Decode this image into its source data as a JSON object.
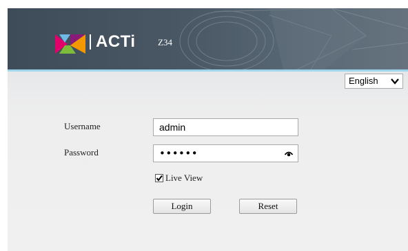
{
  "header": {
    "brand": "ACTi",
    "model": "Z34"
  },
  "language": {
    "selected": "English"
  },
  "form": {
    "username_label": "Username",
    "username_value": "admin",
    "password_label": "Password",
    "password_masked": "••••••",
    "liveview_label": "Live View",
    "liveview_checked": true,
    "login_label": "Login",
    "reset_label": "Reset"
  },
  "icons": {
    "logo": "acti-logo-icon",
    "lang_arrow": "chevron-down-icon",
    "reveal": "eye-icon",
    "check": "checkmark-icon"
  },
  "colors": {
    "banner": "#4a5866",
    "banner_accent": "#9fd6ec",
    "background": "#efefef"
  }
}
